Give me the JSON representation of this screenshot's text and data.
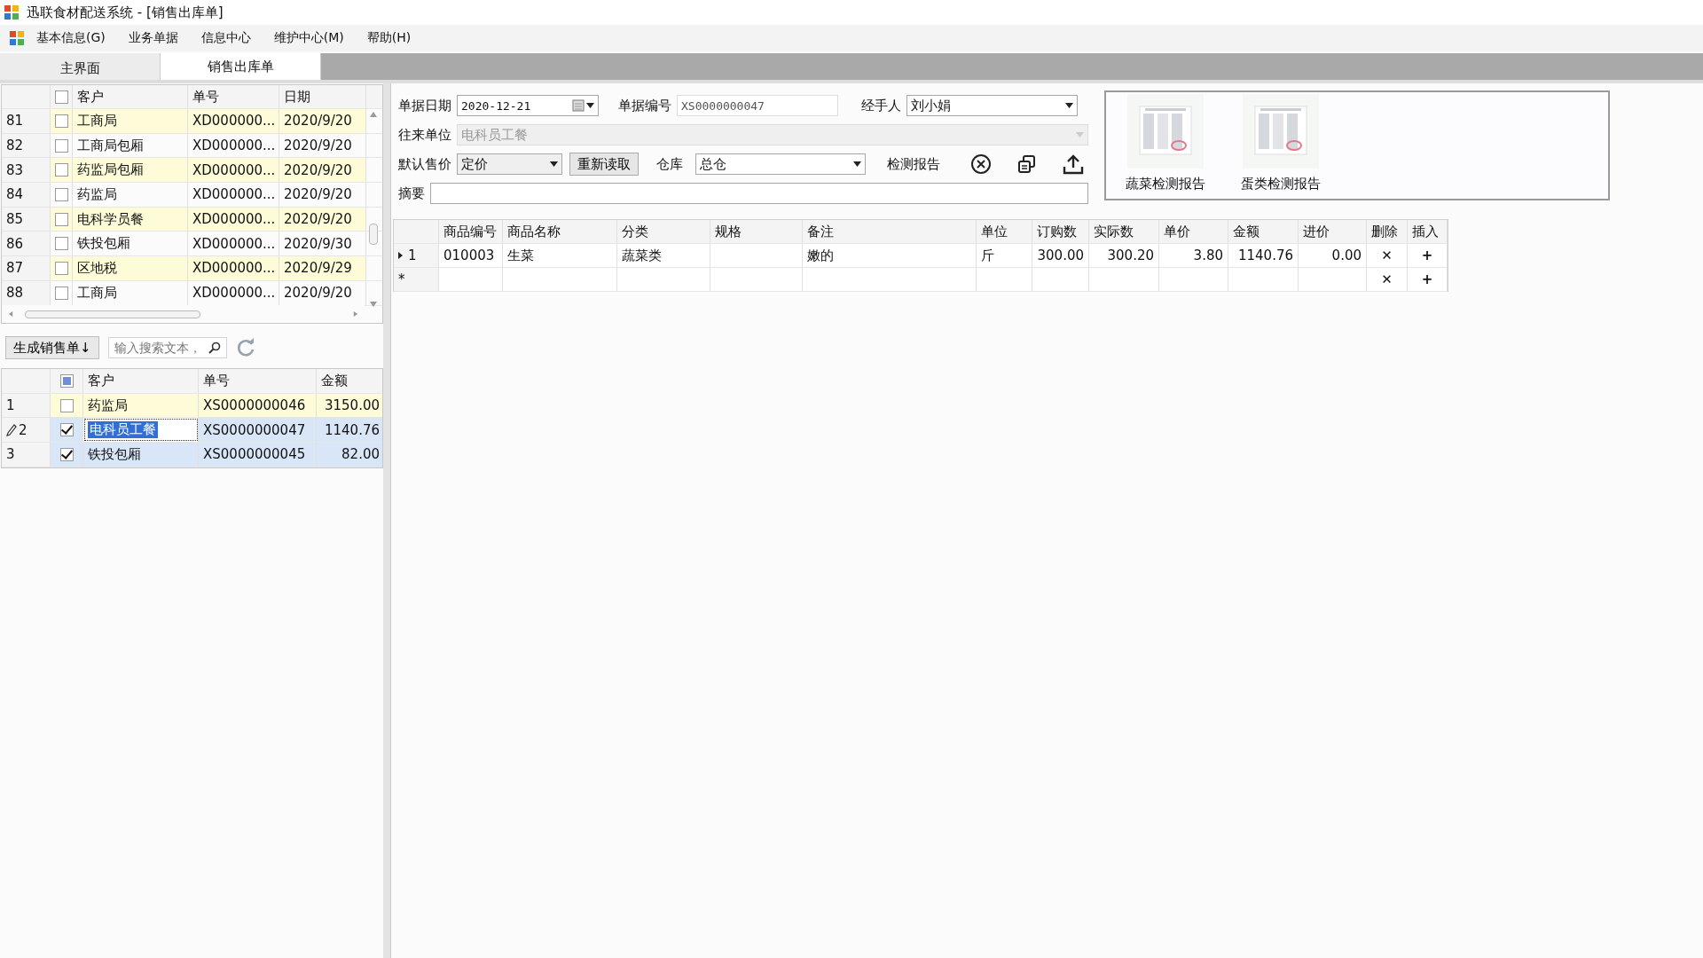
{
  "window": {
    "title": "迅联食材配送系统 - [销售出库单]"
  },
  "menu": [
    "基本信息(G)",
    "业务单据",
    "信息中心",
    "维护中心(M)",
    "帮助(H)"
  ],
  "tabs": [
    {
      "label": "主界面",
      "selected": false
    },
    {
      "label": "销售出库单",
      "selected": true
    }
  ],
  "order_list": {
    "header_checked": false,
    "columns": [
      "客户",
      "单号",
      "日期"
    ],
    "rows": [
      {
        "no": "81",
        "checked": false,
        "customer": "工商局",
        "number": "XD000000...",
        "date": "2020/9/20"
      },
      {
        "no": "82",
        "checked": false,
        "customer": "工商局包厢",
        "number": "XD000000...",
        "date": "2020/9/20"
      },
      {
        "no": "83",
        "checked": false,
        "customer": "药监局包厢",
        "number": "XD000000...",
        "date": "2020/9/20"
      },
      {
        "no": "84",
        "checked": false,
        "customer": "药监局",
        "number": "XD000000...",
        "date": "2020/9/20"
      },
      {
        "no": "85",
        "checked": false,
        "customer": "电科学员餐",
        "number": "XD000000...",
        "date": "2020/9/20"
      },
      {
        "no": "86",
        "checked": false,
        "customer": "铁投包厢",
        "number": "XD000000...",
        "date": "2020/9/30"
      },
      {
        "no": "87",
        "checked": false,
        "customer": "区地税",
        "number": "XD000000...",
        "date": "2020/9/29"
      },
      {
        "no": "88",
        "checked": false,
        "customer": "工商局",
        "number": "XD000000...",
        "date": "2020/9/20"
      }
    ]
  },
  "toolbar": {
    "generate_button": "生成销售单↓",
    "search": {
      "placeholder": "输入搜索文本，"
    }
  },
  "sales_list": {
    "header_partial": true,
    "columns": [
      "客户",
      "单号",
      "金额"
    ],
    "rows": [
      {
        "no": "1",
        "checked": false,
        "selected": false,
        "editing": false,
        "customer": "药监局",
        "number": "XS0000000046",
        "amount": "3150.00"
      },
      {
        "no": "2",
        "checked": true,
        "selected": true,
        "editing": true,
        "customer": "电科员工餐",
        "number": "XS0000000047",
        "amount": "1140.76"
      },
      {
        "no": "3",
        "checked": true,
        "selected": true,
        "editing": false,
        "customer": "铁投包厢",
        "number": "XS0000000045",
        "amount": "82.00"
      }
    ]
  },
  "form": {
    "date": {
      "label": "单据日期",
      "value": "2020-12-21"
    },
    "number": {
      "label": "单据编号",
      "value": "XS0000000047"
    },
    "handler": {
      "label": "经手人",
      "value": "刘小娟"
    },
    "partner": {
      "label": "往来单位",
      "value": "电科员工餐",
      "disabled": true
    },
    "price": {
      "label": "默认售价",
      "value": "定价"
    },
    "reload_button": "重新读取",
    "warehouse": {
      "label": "仓库",
      "value": "总仓"
    },
    "report_label": "检测报告",
    "summary": {
      "label": "摘要"
    }
  },
  "reports": [
    {
      "caption": "蔬菜检测报告",
      "kind": "picture"
    },
    {
      "caption": "蛋类检测报告",
      "kind": "picture"
    }
  ],
  "detail": {
    "columns": [
      "商品编号",
      "商品名称",
      "分类",
      "规格",
      "备注",
      "单位",
      "订购数",
      "实际数",
      "单价",
      "金额",
      "进价",
      "删除",
      "插入"
    ],
    "rows": [
      {
        "no": "1",
        "current": true,
        "cells": [
          "010003",
          "生菜",
          "蔬菜类",
          "",
          "嫩的",
          "斤",
          "300.00",
          "300.20",
          "3.80",
          "1140.76",
          "0.00"
        ],
        "delete": "✕",
        "insert": "+"
      }
    ],
    "new_row": {
      "marker": "*",
      "delete": "✕",
      "insert": "+"
    }
  }
}
